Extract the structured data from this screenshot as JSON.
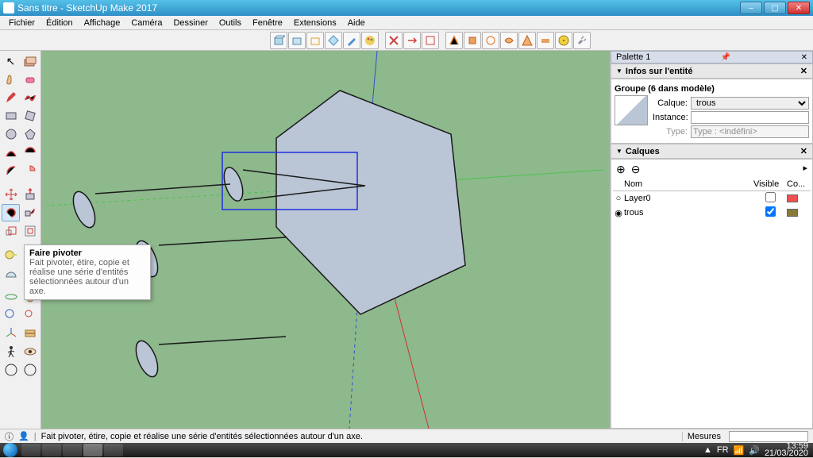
{
  "title": "Sans titre - SketchUp Make 2017",
  "menu": [
    "Fichier",
    "Édition",
    "Affichage",
    "Caméra",
    "Dessiner",
    "Outils",
    "Fenêtre",
    "Extensions",
    "Aide"
  ],
  "status": "Fait pivoter, étire, copie et réalise une série d'entités sélectionnées autour d'un axe.",
  "measuresLabel": "Mesures",
  "panel": {
    "palette": "Palette 1",
    "entity": "Infos sur l'entité",
    "group": "Groupe (6 dans modèle)",
    "layerLbl": "Calque:",
    "layerVal": "trous",
    "instanceLbl": "Instance:",
    "typeLbl": "Type:",
    "typeVal": "Type : <indéfini>",
    "layersHdr": "Calques",
    "cols": {
      "name": "Nom",
      "vis": "Visible",
      "col": "Co..."
    },
    "rows": [
      {
        "name": "Layer0",
        "checked": false,
        "color": "#f05050"
      },
      {
        "name": "trous",
        "checked": true,
        "color": "#8a7a3a"
      }
    ]
  },
  "tooltip": {
    "title": "Faire pivoter",
    "body": "Fait pivoter, étire, copie et réalise une série d'entités sélectionnées autour d'un axe."
  },
  "tray": {
    "lang": "FR",
    "time": "13:59",
    "date": "21/03/2020"
  }
}
